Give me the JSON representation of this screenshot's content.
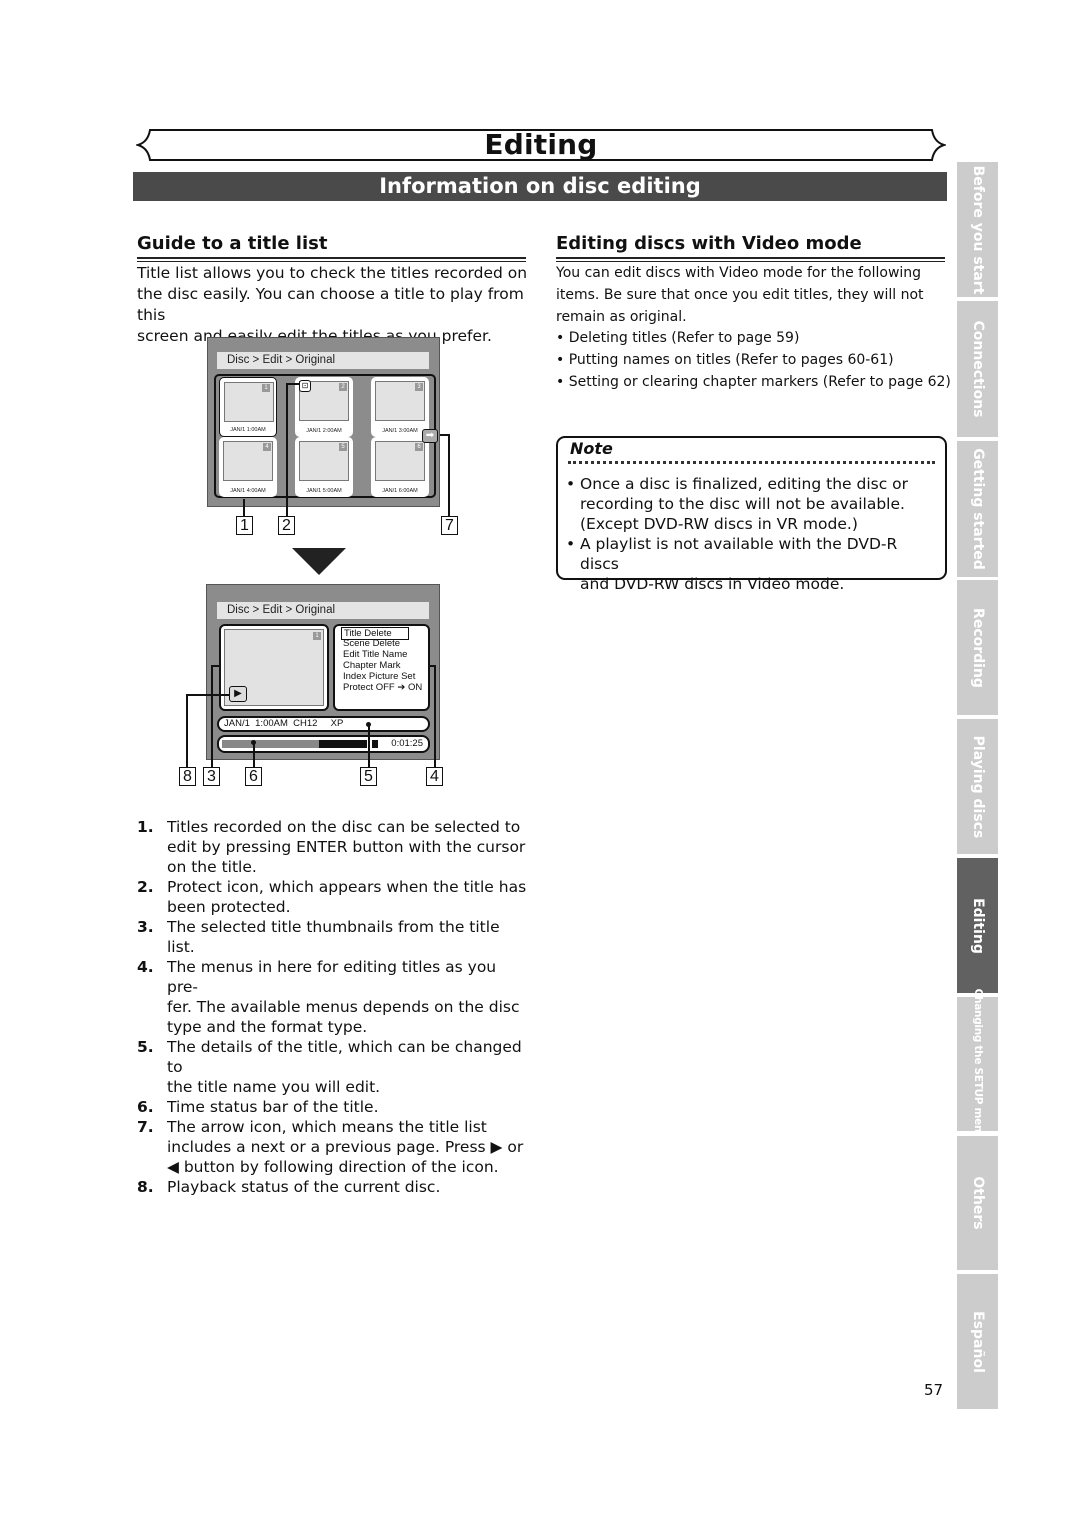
{
  "header": {
    "chapter_title": "Editing",
    "section_title": "Information on disc editing"
  },
  "guide": {
    "heading": "Guide to a title list",
    "intro_lines": [
      "Title list allows you to check the titles recorded on",
      "the disc easily. You can choose a title to play from this",
      "screen and easily edit the titles as you prefer."
    ]
  },
  "screen1": {
    "breadcrumb": "Disc > Edit > Original",
    "thumbnails": [
      {
        "number": "1",
        "date": "JAN/1   1:00AM",
        "selected": true,
        "protected": false
      },
      {
        "number": "2",
        "date": "JAN/1   2:00AM",
        "selected": false,
        "protected": true
      },
      {
        "number": "3",
        "date": "JAN/1   3:00AM",
        "selected": false,
        "protected": false
      },
      {
        "number": "4",
        "date": "JAN/1   4:00AM",
        "selected": false,
        "protected": false
      },
      {
        "number": "5",
        "date": "JAN/1   5:00AM",
        "selected": false,
        "protected": false
      },
      {
        "number": "6",
        "date": "JAN/1   6:00AM",
        "selected": false,
        "protected": false
      }
    ],
    "lock_glyph": "⊡",
    "next_arrow_glyph": "➡",
    "callouts": [
      "1",
      "2",
      "7"
    ]
  },
  "screen2": {
    "breadcrumb": "Disc > Edit > Original",
    "thumb_number": "1",
    "play_glyph": "▶",
    "menu": [
      "Title Delete",
      "Scene Delete",
      "Edit Title Name",
      "Chapter Mark",
      "Index Picture Set",
      "Protect OFF ➔ ON"
    ],
    "selected_menu_index": 0,
    "info": "JAN/1  1:00AM  CH12     XP",
    "time": "0:01:25",
    "callouts": [
      "8",
      "3",
      "6",
      "5",
      "4"
    ]
  },
  "legend": [
    {
      "n": "1.",
      "lines": [
        "Titles recorded on the disc can be selected to",
        "edit by pressing ENTER button with the cursor",
        "on the title."
      ]
    },
    {
      "n": "2.",
      "lines": [
        "Protect icon, which appears when the title has",
        "been protected."
      ]
    },
    {
      "n": "3.",
      "lines": [
        "The selected title thumbnails from the title list."
      ]
    },
    {
      "n": "4.",
      "lines": [
        "The menus in here for editing titles as you pre-",
        "fer. The available menus depends on the disc",
        "type and the format type."
      ]
    },
    {
      "n": "5.",
      "lines": [
        "The details of the title, which can be changed to",
        "the title name you will edit."
      ]
    },
    {
      "n": "6.",
      "lines": [
        "Time status bar of the title."
      ]
    },
    {
      "n": "7.",
      "lines": [
        "The arrow icon, which means the title list",
        "includes a next or a previous page. Press ▶ or",
        "◀ button by following direction of the icon."
      ]
    },
    {
      "n": "8.",
      "lines": [
        "Playback status of the current disc."
      ]
    }
  ],
  "video_mode": {
    "heading": "Editing discs with Video mode",
    "intro_lines": [
      "You can edit discs with Video mode for the following",
      "items. Be sure that once you edit titles, they will not",
      "remain as original."
    ],
    "bullets": [
      "• Deleting titles (Refer to page 59)",
      "• Putting names on titles (Refer to pages 60-61)",
      "• Setting or clearing chapter markers (Refer to page 62)"
    ]
  },
  "note": {
    "title": "Note",
    "items": [
      [
        "Once a disc is finalized, editing the disc or",
        "recording to the disc will not be available.",
        "(Except DVD-RW discs in VR mode.)"
      ],
      [
        "A playlist is not available with the DVD-R discs",
        "and DVD-RW discs in Video mode."
      ]
    ],
    "bullet": "•"
  },
  "side_tabs": [
    {
      "label": "Before you start",
      "active": false
    },
    {
      "label": "Connections",
      "active": false
    },
    {
      "label": "Getting started",
      "active": false
    },
    {
      "label": "Recording",
      "active": false
    },
    {
      "label": "Playing discs",
      "active": false
    },
    {
      "label": "Editing",
      "active": true
    },
    {
      "label": "Changing the SETUP menu",
      "active": false
    },
    {
      "label": "Others",
      "active": false
    },
    {
      "label": "Español",
      "active": false
    }
  ],
  "page_number": "57",
  "colors": {
    "section_bar": "#4a4a4a",
    "tab_inactive": "#cccccc",
    "tab_active": "#616161",
    "screen_bg": "#8c8c8c"
  }
}
